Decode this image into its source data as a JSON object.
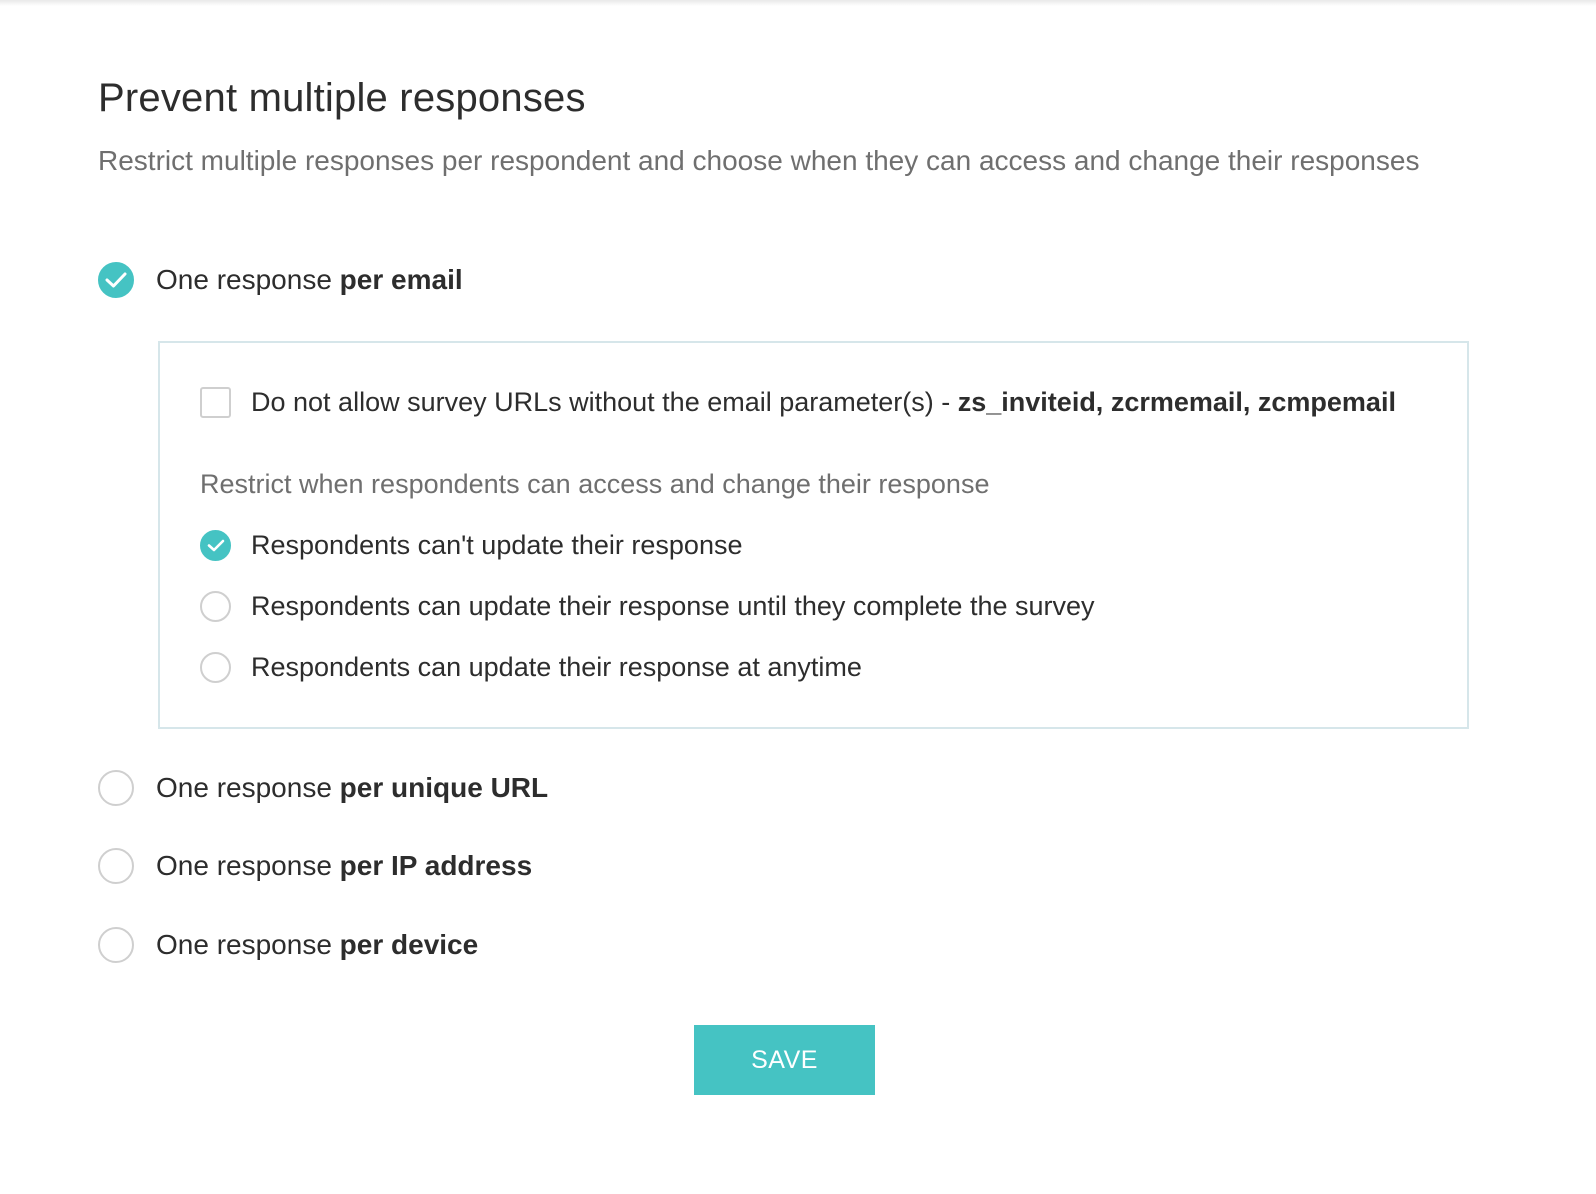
{
  "header": {
    "title": "Prevent multiple responses",
    "subtitle": "Restrict multiple responses per respondent and choose when they can access and change their responses"
  },
  "options": [
    {
      "prefix": "One response ",
      "bold": "per email",
      "checked": true
    },
    {
      "prefix": "One response ",
      "bold": "per unique URL",
      "checked": false
    },
    {
      "prefix": "One response ",
      "bold": "per IP address",
      "checked": false
    },
    {
      "prefix": "One response ",
      "bold": "per device",
      "checked": false
    }
  ],
  "email_panel": {
    "checkbox": {
      "prefix": "Do not allow survey URLs without the email parameter(s) - ",
      "bold": "zs_inviteid, zcrmemail, zcmpemail",
      "checked": false
    },
    "restrict_label": "Restrict when respondents can access and change their response",
    "sub_options": [
      {
        "label": "Respondents can't update their response",
        "checked": true
      },
      {
        "label": "Respondents can update their response until they complete the survey",
        "checked": false
      },
      {
        "label": "Respondents can update their response at anytime",
        "checked": false
      }
    ]
  },
  "save_label": "SAVE",
  "colors": {
    "accent": "#45c3c3",
    "panel_border": "#d6e6ea"
  }
}
